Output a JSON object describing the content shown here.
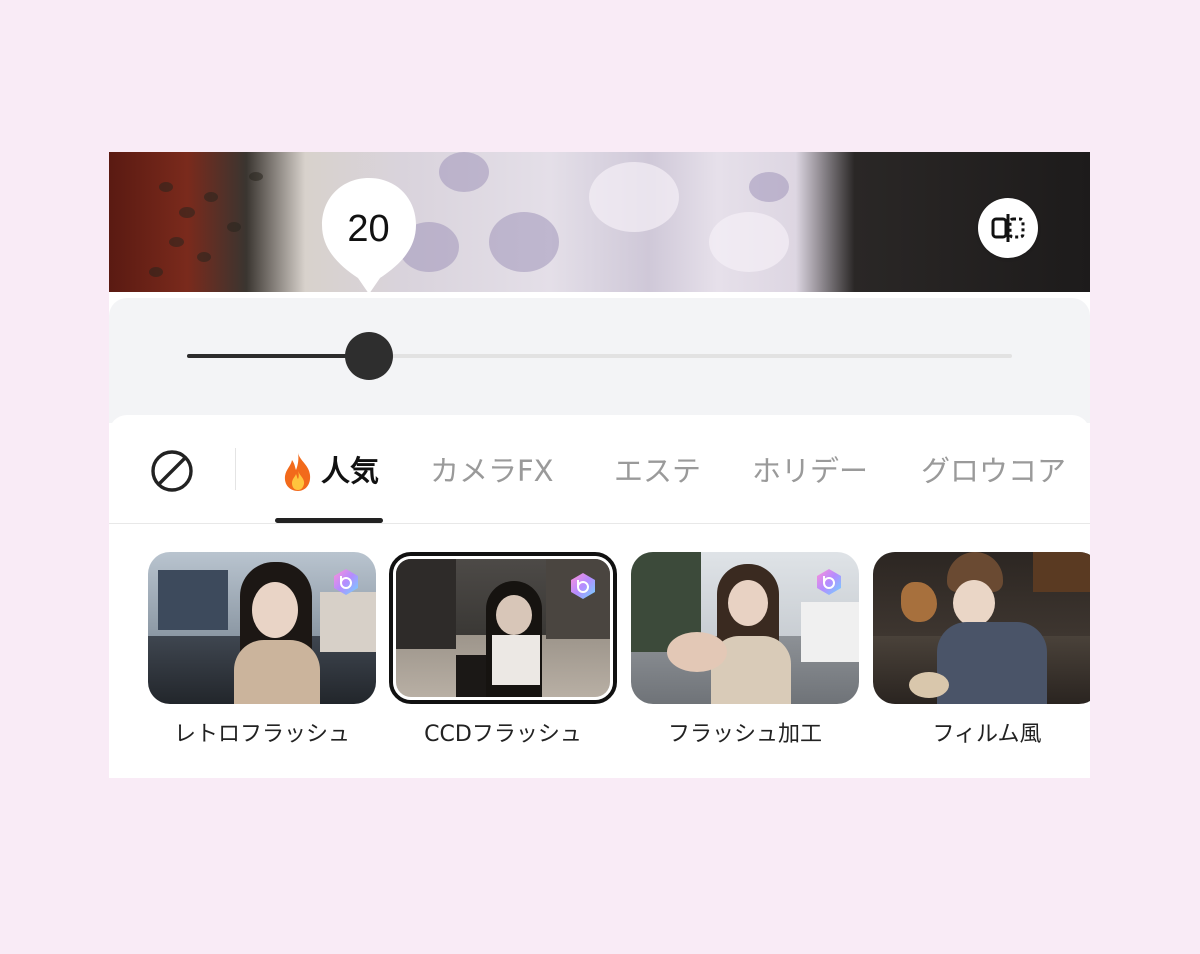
{
  "slider": {
    "value_label": "20",
    "value_percent": 22
  },
  "compare_button": {
    "icon": "compare-split-icon"
  },
  "tabs": {
    "none_icon": "no-filter-icon",
    "items": [
      {
        "label": "人気",
        "icon": "fire-icon",
        "active": true
      },
      {
        "label": "カメラFX",
        "active": false
      },
      {
        "label": "エステ",
        "active": false
      },
      {
        "label": "ホリデー",
        "active": false
      },
      {
        "label": "グロウコア",
        "active": false
      }
    ]
  },
  "filters": [
    {
      "label": "レトロフラッシュ",
      "premium": true,
      "selected": false
    },
    {
      "label": "CCDフラッシュ",
      "premium": true,
      "selected": true
    },
    {
      "label": "フラッシュ加工",
      "premium": true,
      "selected": false
    },
    {
      "label": "フィルム風",
      "premium": false,
      "selected": false
    }
  ],
  "colors": {
    "background": "#f9ebf6",
    "accent": "#111111",
    "slider_panel": "#f3f4f6"
  }
}
